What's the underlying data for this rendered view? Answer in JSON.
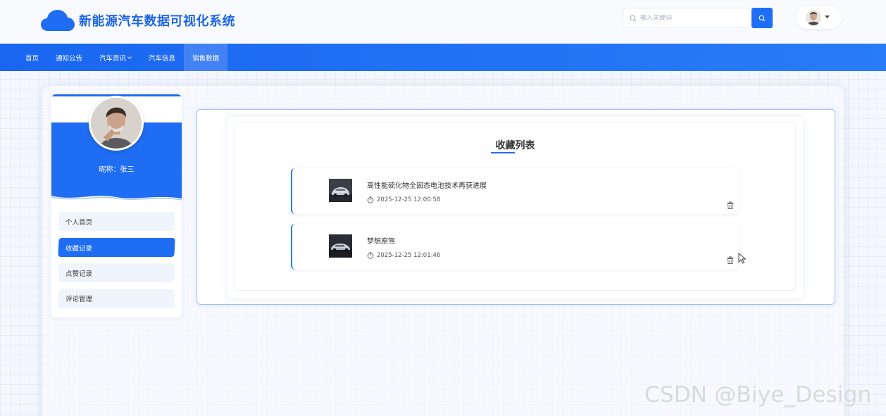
{
  "header": {
    "site_title": "新能源汽车数据可视化系统",
    "search": {
      "placeholder": "输入关键词",
      "value": ""
    }
  },
  "nav": {
    "items": [
      {
        "label": "首页"
      },
      {
        "label": "通知公告"
      },
      {
        "label": "汽车资讯",
        "has_dropdown": true
      },
      {
        "label": "汽车信息"
      },
      {
        "label": "销售数据",
        "active": true
      }
    ]
  },
  "profile": {
    "nickname": "昵称：张三"
  },
  "side_menu": {
    "items": [
      {
        "label": "个人首页"
      },
      {
        "label": "收藏记录",
        "active": true
      },
      {
        "label": "点赞记录"
      },
      {
        "label": "评论管理"
      }
    ]
  },
  "favorites": {
    "title": "收藏列表",
    "items": [
      {
        "title": "高性能硫化物全固态电池技术再获进展",
        "time": "2025-12-25 12:00:58"
      },
      {
        "title": "梦想座驾",
        "time": "2025-12-25 12:01:46"
      }
    ]
  },
  "watermark": "CSDN @Biye_Design",
  "colors": {
    "primary": "#1f6df2",
    "nav_start": "#1a66f0",
    "nav_end": "#2a7bf7",
    "side_item_bg": "#f0f5fd"
  }
}
